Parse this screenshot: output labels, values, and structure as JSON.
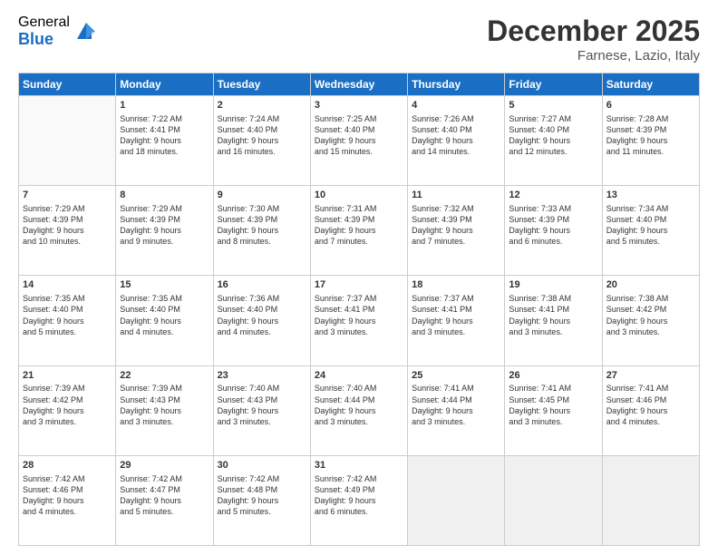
{
  "logo": {
    "general": "General",
    "blue": "Blue"
  },
  "title": "December 2025",
  "location": "Farnese, Lazio, Italy",
  "days": [
    "Sunday",
    "Monday",
    "Tuesday",
    "Wednesday",
    "Thursday",
    "Friday",
    "Saturday"
  ],
  "weeks": [
    [
      {
        "num": "",
        "lines": []
      },
      {
        "num": "1",
        "lines": [
          "Sunrise: 7:22 AM",
          "Sunset: 4:41 PM",
          "Daylight: 9 hours",
          "and 18 minutes."
        ]
      },
      {
        "num": "2",
        "lines": [
          "Sunrise: 7:24 AM",
          "Sunset: 4:40 PM",
          "Daylight: 9 hours",
          "and 16 minutes."
        ]
      },
      {
        "num": "3",
        "lines": [
          "Sunrise: 7:25 AM",
          "Sunset: 4:40 PM",
          "Daylight: 9 hours",
          "and 15 minutes."
        ]
      },
      {
        "num": "4",
        "lines": [
          "Sunrise: 7:26 AM",
          "Sunset: 4:40 PM",
          "Daylight: 9 hours",
          "and 14 minutes."
        ]
      },
      {
        "num": "5",
        "lines": [
          "Sunrise: 7:27 AM",
          "Sunset: 4:40 PM",
          "Daylight: 9 hours",
          "and 12 minutes."
        ]
      },
      {
        "num": "6",
        "lines": [
          "Sunrise: 7:28 AM",
          "Sunset: 4:39 PM",
          "Daylight: 9 hours",
          "and 11 minutes."
        ]
      }
    ],
    [
      {
        "num": "7",
        "lines": [
          "Sunrise: 7:29 AM",
          "Sunset: 4:39 PM",
          "Daylight: 9 hours",
          "and 10 minutes."
        ]
      },
      {
        "num": "8",
        "lines": [
          "Sunrise: 7:29 AM",
          "Sunset: 4:39 PM",
          "Daylight: 9 hours",
          "and 9 minutes."
        ]
      },
      {
        "num": "9",
        "lines": [
          "Sunrise: 7:30 AM",
          "Sunset: 4:39 PM",
          "Daylight: 9 hours",
          "and 8 minutes."
        ]
      },
      {
        "num": "10",
        "lines": [
          "Sunrise: 7:31 AM",
          "Sunset: 4:39 PM",
          "Daylight: 9 hours",
          "and 7 minutes."
        ]
      },
      {
        "num": "11",
        "lines": [
          "Sunrise: 7:32 AM",
          "Sunset: 4:39 PM",
          "Daylight: 9 hours",
          "and 7 minutes."
        ]
      },
      {
        "num": "12",
        "lines": [
          "Sunrise: 7:33 AM",
          "Sunset: 4:39 PM",
          "Daylight: 9 hours",
          "and 6 minutes."
        ]
      },
      {
        "num": "13",
        "lines": [
          "Sunrise: 7:34 AM",
          "Sunset: 4:40 PM",
          "Daylight: 9 hours",
          "and 5 minutes."
        ]
      }
    ],
    [
      {
        "num": "14",
        "lines": [
          "Sunrise: 7:35 AM",
          "Sunset: 4:40 PM",
          "Daylight: 9 hours",
          "and 5 minutes."
        ]
      },
      {
        "num": "15",
        "lines": [
          "Sunrise: 7:35 AM",
          "Sunset: 4:40 PM",
          "Daylight: 9 hours",
          "and 4 minutes."
        ]
      },
      {
        "num": "16",
        "lines": [
          "Sunrise: 7:36 AM",
          "Sunset: 4:40 PM",
          "Daylight: 9 hours",
          "and 4 minutes."
        ]
      },
      {
        "num": "17",
        "lines": [
          "Sunrise: 7:37 AM",
          "Sunset: 4:41 PM",
          "Daylight: 9 hours",
          "and 3 minutes."
        ]
      },
      {
        "num": "18",
        "lines": [
          "Sunrise: 7:37 AM",
          "Sunset: 4:41 PM",
          "Daylight: 9 hours",
          "and 3 minutes."
        ]
      },
      {
        "num": "19",
        "lines": [
          "Sunrise: 7:38 AM",
          "Sunset: 4:41 PM",
          "Daylight: 9 hours",
          "and 3 minutes."
        ]
      },
      {
        "num": "20",
        "lines": [
          "Sunrise: 7:38 AM",
          "Sunset: 4:42 PM",
          "Daylight: 9 hours",
          "and 3 minutes."
        ]
      }
    ],
    [
      {
        "num": "21",
        "lines": [
          "Sunrise: 7:39 AM",
          "Sunset: 4:42 PM",
          "Daylight: 9 hours",
          "and 3 minutes."
        ]
      },
      {
        "num": "22",
        "lines": [
          "Sunrise: 7:39 AM",
          "Sunset: 4:43 PM",
          "Daylight: 9 hours",
          "and 3 minutes."
        ]
      },
      {
        "num": "23",
        "lines": [
          "Sunrise: 7:40 AM",
          "Sunset: 4:43 PM",
          "Daylight: 9 hours",
          "and 3 minutes."
        ]
      },
      {
        "num": "24",
        "lines": [
          "Sunrise: 7:40 AM",
          "Sunset: 4:44 PM",
          "Daylight: 9 hours",
          "and 3 minutes."
        ]
      },
      {
        "num": "25",
        "lines": [
          "Sunrise: 7:41 AM",
          "Sunset: 4:44 PM",
          "Daylight: 9 hours",
          "and 3 minutes."
        ]
      },
      {
        "num": "26",
        "lines": [
          "Sunrise: 7:41 AM",
          "Sunset: 4:45 PM",
          "Daylight: 9 hours",
          "and 3 minutes."
        ]
      },
      {
        "num": "27",
        "lines": [
          "Sunrise: 7:41 AM",
          "Sunset: 4:46 PM",
          "Daylight: 9 hours",
          "and 4 minutes."
        ]
      }
    ],
    [
      {
        "num": "28",
        "lines": [
          "Sunrise: 7:42 AM",
          "Sunset: 4:46 PM",
          "Daylight: 9 hours",
          "and 4 minutes."
        ]
      },
      {
        "num": "29",
        "lines": [
          "Sunrise: 7:42 AM",
          "Sunset: 4:47 PM",
          "Daylight: 9 hours",
          "and 5 minutes."
        ]
      },
      {
        "num": "30",
        "lines": [
          "Sunrise: 7:42 AM",
          "Sunset: 4:48 PM",
          "Daylight: 9 hours",
          "and 5 minutes."
        ]
      },
      {
        "num": "31",
        "lines": [
          "Sunrise: 7:42 AM",
          "Sunset: 4:49 PM",
          "Daylight: 9 hours",
          "and 6 minutes."
        ]
      },
      {
        "num": "",
        "lines": []
      },
      {
        "num": "",
        "lines": []
      },
      {
        "num": "",
        "lines": []
      }
    ]
  ]
}
